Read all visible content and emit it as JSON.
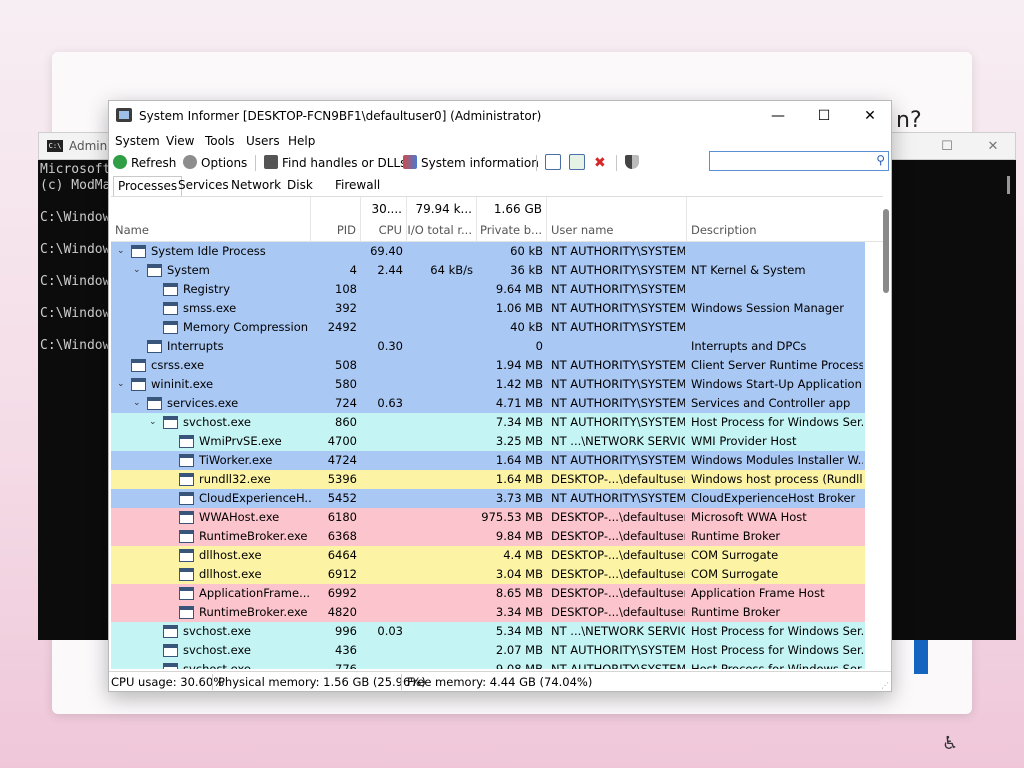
{
  "oobe": {
    "question_mark_text": "n?"
  },
  "cmd": {
    "title": "Admini",
    "icon_label": "C:\\",
    "lines": [
      "Microsoft",
      "(c) ModMa",
      "",
      "C:\\Window",
      "",
      "C:\\Window",
      "",
      "C:\\Window",
      "",
      "C:\\Window",
      "",
      "C:\\Window"
    ]
  },
  "window": {
    "title": "System Informer [DESKTOP-FCN9BF1\\defaultuser0] (Administrator)",
    "menu": [
      "System",
      "View",
      "Tools",
      "Users",
      "Help"
    ],
    "toolbar": {
      "refresh": "Refresh",
      "options": "Options",
      "find": "Find handles or DLLs",
      "sysinfo": "System information"
    },
    "search": {
      "value": "",
      "placeholder": ""
    },
    "tabs": [
      "Processes",
      "Services",
      "Network",
      "Disk",
      "Firewall"
    ],
    "columns": {
      "name": "Name",
      "pid": "PID",
      "cpu": "CPU",
      "io": "I/O total r...",
      "private": "Private b...",
      "user": "User name",
      "desc": "Description"
    },
    "totals": {
      "cpu": "30....",
      "io": "79.94 k...",
      "private": "1.66 GB"
    },
    "rows": [
      {
        "name": "System Idle Process",
        "pid": "",
        "cpu": "69.40",
        "io": "",
        "priv": "60 kB",
        "user": "NT AUTHORITY\\SYSTEM",
        "desc": "",
        "bg": "#aac8f4",
        "level": 0,
        "exp": "v"
      },
      {
        "name": "System",
        "pid": "4",
        "cpu": "2.44",
        "io": "64 kB/s",
        "priv": "36 kB",
        "user": "NT AUTHORITY\\SYSTEM",
        "desc": "NT Kernel & System",
        "bg": "#aac8f4",
        "level": 1,
        "exp": "v"
      },
      {
        "name": "Registry",
        "pid": "108",
        "cpu": "",
        "io": "",
        "priv": "9.64 MB",
        "user": "NT AUTHORITY\\SYSTEM",
        "desc": "",
        "bg": "#aac8f4",
        "level": 2,
        "exp": ""
      },
      {
        "name": "smss.exe",
        "pid": "392",
        "cpu": "",
        "io": "",
        "priv": "1.06 MB",
        "user": "NT AUTHORITY\\SYSTEM",
        "desc": "Windows Session Manager",
        "bg": "#aac8f4",
        "level": 2,
        "exp": ""
      },
      {
        "name": "Memory Compression",
        "pid": "2492",
        "cpu": "",
        "io": "",
        "priv": "40 kB",
        "user": "NT AUTHORITY\\SYSTEM",
        "desc": "",
        "bg": "#aac8f4",
        "level": 2,
        "exp": ""
      },
      {
        "name": "Interrupts",
        "pid": "",
        "cpu": "0.30",
        "io": "",
        "priv": "0",
        "user": "",
        "desc": "Interrupts and DPCs",
        "bg": "#aac8f4",
        "level": 1,
        "exp": ""
      },
      {
        "name": "csrss.exe",
        "pid": "508",
        "cpu": "",
        "io": "",
        "priv": "1.94 MB",
        "user": "NT AUTHORITY\\SYSTEM",
        "desc": "Client Server Runtime Process",
        "bg": "#aac8f4",
        "level": 0,
        "exp": ""
      },
      {
        "name": "wininit.exe",
        "pid": "580",
        "cpu": "",
        "io": "",
        "priv": "1.42 MB",
        "user": "NT AUTHORITY\\SYSTEM",
        "desc": "Windows Start-Up Application",
        "bg": "#aac8f4",
        "level": 0,
        "exp": "v"
      },
      {
        "name": "services.exe",
        "pid": "724",
        "cpu": "0.63",
        "io": "",
        "priv": "4.71 MB",
        "user": "NT AUTHORITY\\SYSTEM",
        "desc": "Services and Controller app",
        "bg": "#aac8f4",
        "level": 1,
        "exp": "v"
      },
      {
        "name": "svchost.exe",
        "pid": "860",
        "cpu": "",
        "io": "",
        "priv": "7.34 MB",
        "user": "NT AUTHORITY\\SYSTEM",
        "desc": "Host Process for Windows Ser...",
        "bg": "#c4f4f4",
        "level": 2,
        "exp": "v"
      },
      {
        "name": "WmiPrvSE.exe",
        "pid": "4700",
        "cpu": "",
        "io": "",
        "priv": "3.25 MB",
        "user": "NT ...\\NETWORK SERVICE",
        "desc": "WMI Provider Host",
        "bg": "#c4f4f4",
        "level": 3,
        "exp": ""
      },
      {
        "name": "TiWorker.exe",
        "pid": "4724",
        "cpu": "",
        "io": "",
        "priv": "1.64 MB",
        "user": "NT AUTHORITY\\SYSTEM",
        "desc": "Windows Modules Installer W...",
        "bg": "#aac8f4",
        "level": 3,
        "exp": ""
      },
      {
        "name": "rundll32.exe",
        "pid": "5396",
        "cpu": "",
        "io": "",
        "priv": "1.64 MB",
        "user": "DESKTOP-...\\defaultusero",
        "desc": "Windows host process (Rundll...",
        "bg": "#fcf4a4",
        "level": 3,
        "exp": ""
      },
      {
        "name": "CloudExperienceH...",
        "pid": "5452",
        "cpu": "",
        "io": "",
        "priv": "3.73 MB",
        "user": "NT AUTHORITY\\SYSTEM",
        "desc": "CloudExperienceHost Broker",
        "bg": "#aac8f4",
        "level": 3,
        "exp": ""
      },
      {
        "name": "WWAHost.exe",
        "pid": "6180",
        "cpu": "",
        "io": "",
        "priv": "975.53 MB",
        "user": "DESKTOP-...\\defaultusero",
        "desc": "Microsoft WWA Host",
        "bg": "#fcc4cc",
        "level": 3,
        "exp": ""
      },
      {
        "name": "RuntimeBroker.exe",
        "pid": "6368",
        "cpu": "",
        "io": "",
        "priv": "9.84 MB",
        "user": "DESKTOP-...\\defaultusero",
        "desc": "Runtime Broker",
        "bg": "#fcc4cc",
        "level": 3,
        "exp": ""
      },
      {
        "name": "dllhost.exe",
        "pid": "6464",
        "cpu": "",
        "io": "",
        "priv": "4.4 MB",
        "user": "DESKTOP-...\\defaultusero",
        "desc": "COM Surrogate",
        "bg": "#fcf4a4",
        "level": 3,
        "exp": ""
      },
      {
        "name": "dllhost.exe",
        "pid": "6912",
        "cpu": "",
        "io": "",
        "priv": "3.04 MB",
        "user": "DESKTOP-...\\defaultusero",
        "desc": "COM Surrogate",
        "bg": "#fcf4a4",
        "level": 3,
        "exp": ""
      },
      {
        "name": "ApplicationFrame...",
        "pid": "6992",
        "cpu": "",
        "io": "",
        "priv": "8.65 MB",
        "user": "DESKTOP-...\\defaultusero",
        "desc": "Application Frame Host",
        "bg": "#fcc4cc",
        "level": 3,
        "exp": ""
      },
      {
        "name": "RuntimeBroker.exe",
        "pid": "4820",
        "cpu": "",
        "io": "",
        "priv": "3.34 MB",
        "user": "DESKTOP-...\\defaultusero",
        "desc": "Runtime Broker",
        "bg": "#fcc4cc",
        "level": 3,
        "exp": ""
      },
      {
        "name": "svchost.exe",
        "pid": "996",
        "cpu": "0.03",
        "io": "",
        "priv": "5.34 MB",
        "user": "NT ...\\NETWORK SERVICE",
        "desc": "Host Process for Windows Ser...",
        "bg": "#c4f4f4",
        "level": 2,
        "exp": ""
      },
      {
        "name": "svchost.exe",
        "pid": "436",
        "cpu": "",
        "io": "",
        "priv": "2.07 MB",
        "user": "NT AUTHORITY\\SYSTEM",
        "desc": "Host Process for Windows Ser...",
        "bg": "#c4f4f4",
        "level": 2,
        "exp": ""
      },
      {
        "name": "svchost.exe",
        "pid": "776",
        "cpu": "",
        "io": "",
        "priv": "9.08 MB",
        "user": "NT AUTHORITY\\SYSTEM",
        "desc": "Host Process for Windows Ser...",
        "bg": "#c4f4f4",
        "level": 2,
        "exp": ""
      }
    ],
    "status": {
      "cpu": "CPU usage: 30.60%",
      "physical": "Physical memory: 1.56 GB (25.96%)",
      "free": "Free memory: 4.44 GB (74.04%)"
    }
  }
}
